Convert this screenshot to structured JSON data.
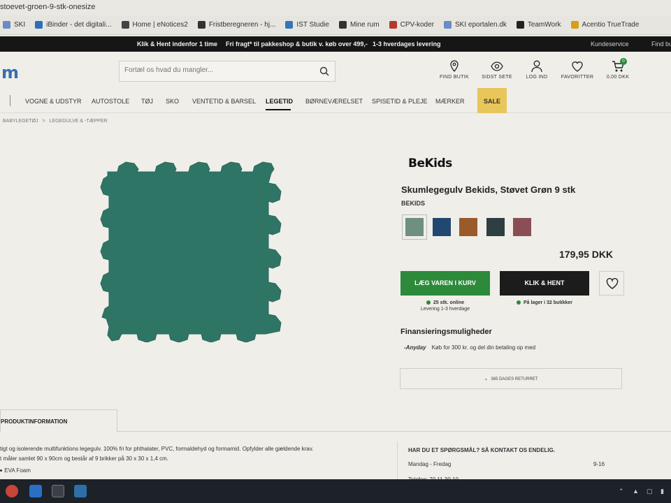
{
  "browser": {
    "url_fragment": "stoevet-groen-9-stk-onesize",
    "bookmarks": [
      {
        "label": "SKI",
        "color": "#6b8bc4"
      },
      {
        "label": "iBinder - det digitali...",
        "color": "#2e6fb7"
      },
      {
        "label": "Home | eNotices2",
        "color": "#444444"
      },
      {
        "label": "Fristberegneren - hj...",
        "color": "#333333"
      },
      {
        "label": "IST Studie",
        "color": "#3576b8"
      },
      {
        "label": "Mine rum",
        "color": "#333333"
      },
      {
        "label": "CPV-koder",
        "color": "#b03a2e"
      },
      {
        "label": "SKI eportalen.dk",
        "color": "#6b8bc4"
      },
      {
        "label": "TeamWork",
        "color": "#222222"
      },
      {
        "label": "Acentio TrueTrade",
        "color": "#d4a017"
      }
    ]
  },
  "promo": {
    "item1": "Klik & Hent indenfor 1 time",
    "item2": "Fri fragt* til pakkeshop & butik v. køb over 499,-",
    "item3": "1-3 hverdages levering",
    "service": "Kundeservice",
    "find": "Find bu"
  },
  "header": {
    "logo": "m",
    "search_placeholder": "Fortæl os hvad du mangler...",
    "icons": [
      {
        "label": "FIND BUTIK",
        "icon": "location-pin-icon"
      },
      {
        "label": "SIDST SETE",
        "icon": "eye-icon"
      },
      {
        "label": "LOG IND",
        "icon": "user-icon"
      },
      {
        "label": "FAVORITTER",
        "icon": "heart-icon"
      },
      {
        "label": "0,00 DKK",
        "icon": "cart-icon"
      }
    ],
    "cart_count": "0"
  },
  "nav": {
    "items": [
      "VOGNE & UDSTYR",
      "AUTOSTOLE",
      "TØJ",
      "SKO",
      "VENTETID & BARSEL",
      "LEGETID",
      "BØRNEVÆRELSET",
      "SPISETID & PLEJE",
      "MÆRKER"
    ],
    "active": "LEGETID",
    "sale": "SALE"
  },
  "breadcrumb": {
    "part1": "BABYLEGETØJ",
    "sep": ">",
    "part2": "LEGEGULVE & -TÆPPER"
  },
  "product": {
    "brand_logo": "BeKids",
    "title": "Skumlegegulv Bekids, Støvet Grøn 9 stk",
    "brand": "BEKIDS",
    "image_color": "#2f7566",
    "swatches": [
      {
        "color": "#6f8f7f",
        "selected": true
      },
      {
        "color": "#22486f",
        "selected": false
      },
      {
        "color": "#9a5a2a",
        "selected": false
      },
      {
        "color": "#2e3e42",
        "selected": false
      },
      {
        "color": "#8a4f55",
        "selected": false
      }
    ],
    "price": "179,95 DKK",
    "add_to_cart": "LÆG VAREN I KURV",
    "click_collect": "KLIK & HENT",
    "online_stock": "25 stk. online",
    "delivery": "Levering 1-3 hverdage",
    "store_stock": "På lager i 32 butikker",
    "financing_heading": "Finansieringsmuligheder",
    "anyday_brand": "-Anyday",
    "anyday_text": "Køb for 300 kr. og del din betaling op med",
    "returns": "365 DAGES RETURRET"
  },
  "tabs": {
    "product_info": "PRODUKTINFORMATION"
  },
  "description": {
    "line1": "tigt og isolerende multifunktions legegulv. 100% fri for phthalater, PVC, formaldehyd og formamid. Opfylder alle gældende krav.",
    "line2": "t måler samlet 90 x 90cm og består af 9 brikker på 30 x 30 x 1,4 cm.",
    "feature": "EVA Foam"
  },
  "contact": {
    "heading": "HAR DU ET SPØRGSMÅL? SÅ KONTAKT OS ENDELIG.",
    "days": "Mandag - Fredag",
    "hours": "9-16",
    "phone": "Telefon: 70 11 30 10"
  },
  "colors": {
    "accent_green": "#2c8a3a",
    "sale_yellow": "#e8c65a",
    "dark": "#1c1c1c"
  }
}
